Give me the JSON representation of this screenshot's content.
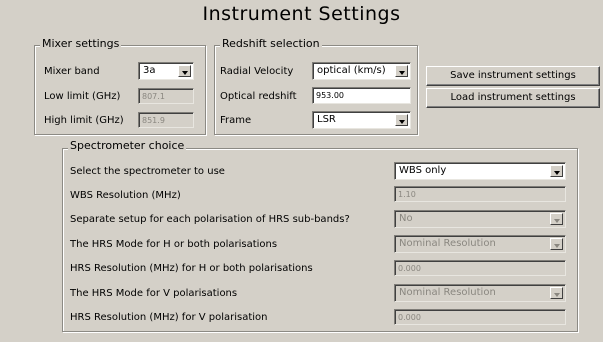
{
  "window": {
    "title": "Instrument Settings"
  },
  "mixer": {
    "legend": "Mixer settings",
    "band_label": "Mixer band",
    "band_value": "3a",
    "low_label": "Low limit (GHz)",
    "low_value": "807.1",
    "high_label": "High limit (GHz)",
    "high_value": "851.9"
  },
  "redshift": {
    "legend": "Redshift selection",
    "radial_label": "Radial Velocity",
    "radial_value": "optical (km/s)",
    "optical_label": "Optical redshift",
    "optical_value": "953.00",
    "frame_label": "Frame",
    "frame_value": "LSR"
  },
  "buttons": {
    "save": "Save instrument settings",
    "load": "Load instrument settings"
  },
  "spectrometer": {
    "legend": "Spectrometer choice",
    "select_label": "Select the spectrometer to use",
    "select_value": "WBS only",
    "wbs_res_label": "WBS Resolution (MHz)",
    "wbs_res_value": "1.10",
    "separate_label": "Separate setup for each polarisation of HRS sub-bands?",
    "separate_value": "No",
    "hrs_mode_h_label": "The HRS Mode for H or both polarisations",
    "hrs_mode_h_value": "Nominal Resolution",
    "hrs_res_h_label": "HRS Resolution (MHz) for H or both polarisations",
    "hrs_res_h_value": "0.000",
    "hrs_mode_v_label": "The HRS Mode for V polarisations",
    "hrs_mode_v_value": "Nominal Resolution",
    "hrs_res_v_label": "HRS Resolution (MHz) for V polarisation",
    "hrs_res_v_value": "0.000"
  }
}
